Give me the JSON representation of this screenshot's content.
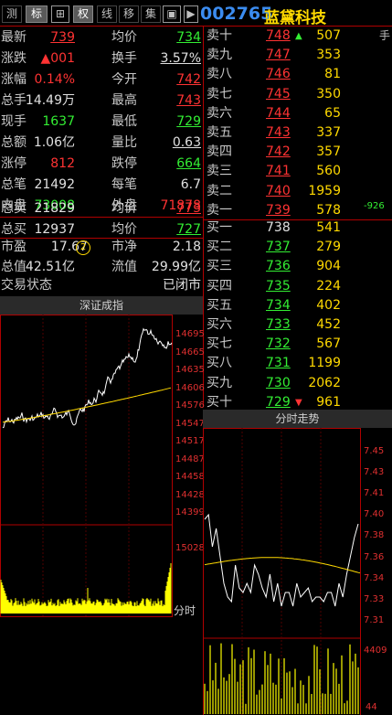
{
  "toolbar": {
    "buttons": [
      "测",
      "标",
      "⊞",
      "权",
      "线",
      "移",
      "集",
      "▣",
      "▶"
    ],
    "code": "002765",
    "name": "蓝黛科技"
  },
  "quote": {
    "rows": [
      {
        "l1": "最新",
        "v1": "739",
        "l2": "均价",
        "v2": "734"
      },
      {
        "l1": "涨跌",
        "v1": "▲001",
        "l2": "换手",
        "v2": "3.57%"
      },
      {
        "l1": "涨幅",
        "v1": "0.14%",
        "l2": "今开",
        "v2": "742"
      },
      {
        "l1": "总手",
        "v1": "14.49万",
        "l2": "最高",
        "v2": "743"
      },
      {
        "l1": "现手",
        "v1": "1637",
        "l2": "最低",
        "v2": "729"
      },
      {
        "l1": "总额",
        "v1": "1.06亿",
        "l2": "量比",
        "v2": "0.63"
      },
      {
        "l1": "涨停",
        "v1": "812",
        "l2": "跌停",
        "v2": "664"
      },
      {
        "l1": "总笔",
        "v1": "21492",
        "l2": "每笔",
        "v2": "6.7"
      },
      {
        "l1": "内盘",
        "v1": "73008",
        "l2": "外盘",
        "v2": "71878"
      },
      {
        "l1": "总卖",
        "v1": "21829",
        "l2": "均价",
        "v2": "773"
      },
      {
        "l1": "总买",
        "v1": "12937",
        "l2": "均价",
        "v2": "727"
      },
      {
        "l1": "市盈",
        "v1": "17.67",
        "l2": "市净",
        "v2": "2.18"
      },
      {
        "l1": "总值",
        "v1": "42.51亿",
        "l2": "流值",
        "v2": "29.99亿"
      }
    ],
    "pe_badge": "2",
    "status_label": "交易状态",
    "status_value": "已闭市"
  },
  "orderbook": {
    "sell": [
      {
        "label": "卖十",
        "price": "748",
        "vol": "507"
      },
      {
        "label": "卖九",
        "price": "747",
        "vol": "353"
      },
      {
        "label": "卖八",
        "price": "746",
        "vol": "81"
      },
      {
        "label": "卖七",
        "price": "745",
        "vol": "350"
      },
      {
        "label": "卖六",
        "price": "744",
        "vol": "65"
      },
      {
        "label": "卖五",
        "price": "743",
        "vol": "337"
      },
      {
        "label": "卖四",
        "price": "742",
        "vol": "357"
      },
      {
        "label": "卖三",
        "price": "741",
        "vol": "560"
      },
      {
        "label": "卖二",
        "price": "740",
        "vol": "1959"
      },
      {
        "label": "卖一",
        "price": "739",
        "vol": "578"
      }
    ],
    "buy": [
      {
        "label": "买一",
        "price": "738",
        "vol": "541"
      },
      {
        "label": "买二",
        "price": "737",
        "vol": "279"
      },
      {
        "label": "买三",
        "price": "736",
        "vol": "904"
      },
      {
        "label": "买四",
        "price": "735",
        "vol": "224"
      },
      {
        "label": "买五",
        "price": "734",
        "vol": "402"
      },
      {
        "label": "买六",
        "price": "733",
        "vol": "452"
      },
      {
        "label": "买七",
        "price": "732",
        "vol": "567"
      },
      {
        "label": "买八",
        "price": "731",
        "vol": "1199"
      },
      {
        "label": "买九",
        "price": "730",
        "vol": "2062"
      },
      {
        "label": "买十",
        "price": "729",
        "vol": "961"
      }
    ],
    "side_char": "手",
    "side_num": "-926"
  },
  "index_chart": {
    "title": "深证成指",
    "ticks": [
      "14695",
      "14665",
      "14635",
      "14606",
      "14576",
      "14547",
      "14517",
      "14487",
      "14458",
      "14428",
      "14399"
    ],
    "vol_tick": "15028",
    "footer": "分时"
  },
  "stock_chart": {
    "title": "分时走势",
    "ticks": [
      "7.45",
      "7.43",
      "7.41",
      "7.40",
      "7.38",
      "7.36",
      "7.34",
      "7.33",
      "7.31"
    ],
    "vol_tick": "4409",
    "vol_tick2": "44"
  },
  "colors": {
    "up": "#ff3333",
    "down": "#33ee33",
    "code": "#3b8cf0",
    "name": "#ffd900",
    "avg": "#ffd900",
    "frame": "#b00000"
  }
}
